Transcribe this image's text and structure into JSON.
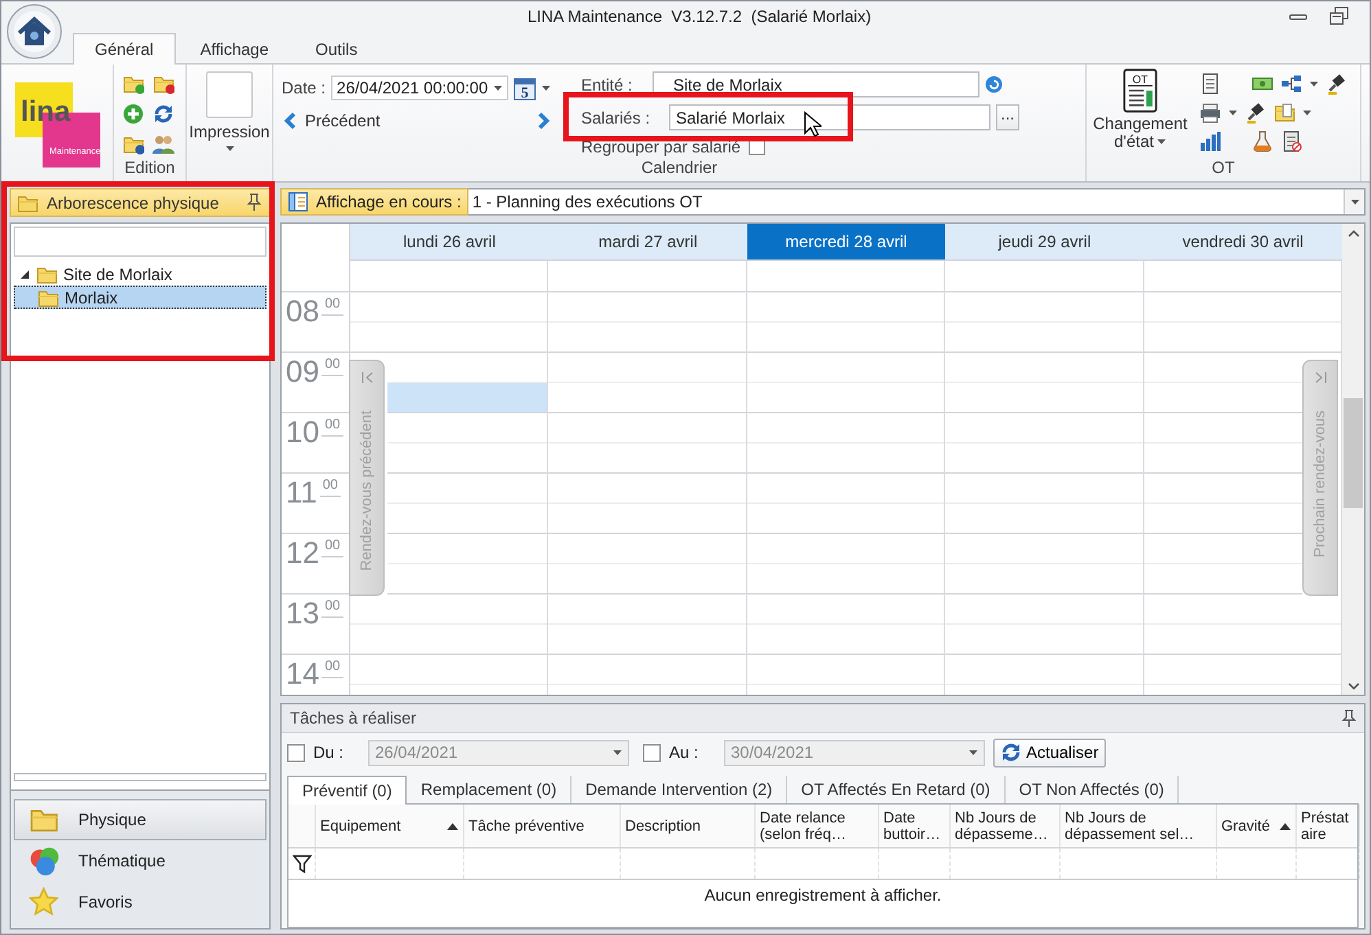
{
  "window": {
    "title": "LINA Maintenance  V3.12.7.2  (Salarié Morlaix)"
  },
  "ribbon": {
    "tabs": [
      {
        "label": "Général",
        "selected": true
      },
      {
        "label": "Affichage",
        "selected": false
      },
      {
        "label": "Outils",
        "selected": false
      }
    ],
    "logo": {
      "name": "lina",
      "tagline": "Maintenance"
    },
    "edition": {
      "label": "Edition"
    },
    "impression": {
      "label": "Impression"
    },
    "calendrier": {
      "label": "Calendrier",
      "date_label": "Date :",
      "date_value": "26/04/2021 00:00:00",
      "date_picker_day": "5",
      "previous": "Précédent",
      "entity_label": "Entité :",
      "entity_value": "Site de Morlaix",
      "employees_label": "Salariés :",
      "employees_value": "Salarié Morlaix",
      "employees_highlighted": true,
      "browse": "...",
      "group_by_employee": {
        "label": "Regrouper par salarié",
        "checked": false
      }
    },
    "ot": {
      "label": "OT",
      "state_change": "Changement d'état",
      "icon_text": "OT"
    }
  },
  "sidebar": {
    "title": "Arborescence physique",
    "highlighted": true,
    "tree": [
      {
        "label": "Site de Morlaix",
        "expanded": true,
        "selected": false,
        "children": [
          {
            "label": "Morlaix",
            "selected": true
          }
        ]
      }
    ],
    "nav": [
      {
        "label": "Physique",
        "kind": "folder",
        "selected": true
      },
      {
        "label": "Thématique",
        "kind": "circles",
        "selected": false
      },
      {
        "label": "Favoris",
        "kind": "star",
        "selected": false
      }
    ]
  },
  "view": {
    "label": "Affichage en cours :",
    "value": "1 - Planning des exécutions OT"
  },
  "calendar": {
    "days": [
      {
        "label": "lundi 26 avril",
        "selected": false,
        "slot_selected": [
          false,
          false,
          false,
          false,
          true,
          false,
          false,
          false,
          false,
          false,
          false,
          false,
          false,
          false
        ]
      },
      {
        "label": "mardi 27 avril",
        "selected": false,
        "slot_selected": [
          false,
          false,
          false,
          false,
          false,
          false,
          false,
          false,
          false,
          false,
          false,
          false,
          false,
          false
        ]
      },
      {
        "label": "mercredi 28 avril",
        "selected": true,
        "slot_selected": [
          false,
          false,
          false,
          false,
          false,
          false,
          false,
          false,
          false,
          false,
          false,
          false,
          false,
          false
        ]
      },
      {
        "label": "jeudi 29 avril",
        "selected": false,
        "slot_selected": [
          false,
          false,
          false,
          false,
          false,
          false,
          false,
          false,
          false,
          false,
          false,
          false,
          false,
          false
        ]
      },
      {
        "label": "vendredi 30 avril",
        "selected": false,
        "slot_selected": [
          false,
          false,
          false,
          false,
          false,
          false,
          false,
          false,
          false,
          false,
          false,
          false,
          false,
          false
        ]
      }
    ],
    "hours": [
      {
        "hour": "08",
        "minutes": "00"
      },
      {
        "hour": "09",
        "minutes": "00"
      },
      {
        "hour": "10",
        "minutes": "00"
      },
      {
        "hour": "11",
        "minutes": "00"
      },
      {
        "hour": "12",
        "minutes": "00"
      },
      {
        "hour": "13",
        "minutes": "00"
      },
      {
        "hour": "14",
        "minutes": "00"
      }
    ],
    "previous_appointment": "Rendez-vous précédent",
    "next_appointment": "Prochain rendez-vous"
  },
  "tasks": {
    "title": "Tâches à réaliser",
    "from": {
      "label": "Du :",
      "checked": false,
      "value": "26/04/2021",
      "disabled": true
    },
    "to": {
      "label": "Au :",
      "checked": false,
      "value": "30/04/2021",
      "disabled": true
    },
    "refresh": "Actualiser",
    "tabs": [
      {
        "label": "Préventif (0)",
        "selected": true
      },
      {
        "label": "Remplacement (0)",
        "selected": false
      },
      {
        "label": "Demande Intervention (2)",
        "selected": false
      },
      {
        "label": "OT Affectés En Retard (0)",
        "selected": false
      },
      {
        "label": "OT Non Affectés (0)",
        "selected": false
      }
    ],
    "columns": [
      {
        "label": "Equipement",
        "sorted": true
      },
      {
        "label": "Tâche préventive",
        "sorted": false
      },
      {
        "label": "Description",
        "sorted": false
      },
      {
        "label": "Date relance (selon fréq…",
        "sorted": false
      },
      {
        "label": "Date buttoir…",
        "sorted": false
      },
      {
        "label": "Nb Jours de dépasseme…",
        "sorted": false
      },
      {
        "label": "Nb Jours de dépassement sel…",
        "sorted": false
      },
      {
        "label": "Gravité",
        "sorted": true
      },
      {
        "label": "Préstataire",
        "sorted": false
      }
    ],
    "empty_message": "Aucun enregistrement à afficher."
  }
}
